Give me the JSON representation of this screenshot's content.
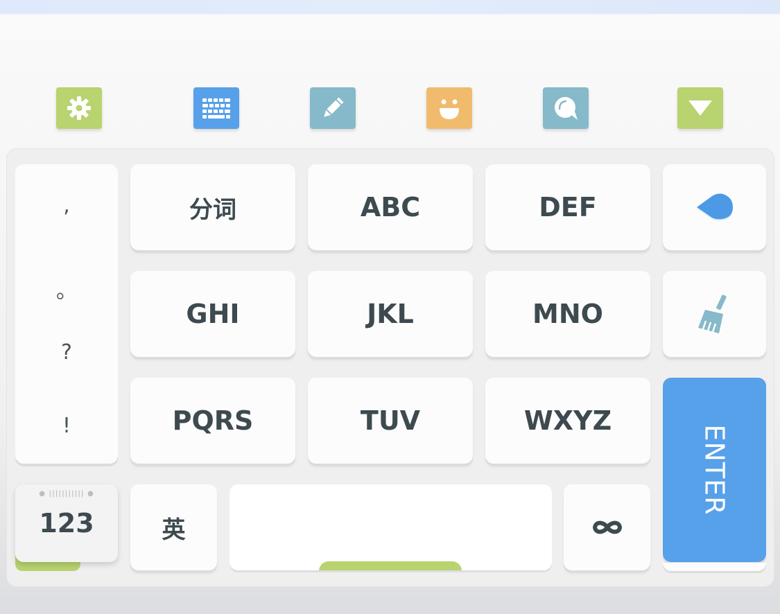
{
  "toolbar": {
    "items": [
      {
        "name": "settings",
        "icon": "gear-icon",
        "color": "#b8d36f"
      },
      {
        "name": "keyboard",
        "icon": "keyboard-icon",
        "color": "#57a0ea"
      },
      {
        "name": "handwriting",
        "icon": "pencil-icon",
        "color": "#86b9c9"
      },
      {
        "name": "emoji",
        "icon": "smiley-icon",
        "color": "#f0bb6c"
      },
      {
        "name": "chat",
        "icon": "chat-bubble-icon",
        "color": "#86b9c9"
      },
      {
        "name": "collapse",
        "icon": "triangle-down-icon",
        "color": "#b8d36f"
      }
    ]
  },
  "keyboard": {
    "punctuation": [
      ",",
      "。",
      "?",
      "!"
    ],
    "keys": {
      "fenci": "分词",
      "abc": "ABC",
      "def": "DEF",
      "ghi": "GHI",
      "jkl": "JKL",
      "mno": "MNO",
      "pqrs": "PQRS",
      "tuv": "TUV",
      "wxyz": "WXYZ"
    },
    "delete_icon": "delete-drop-icon",
    "clear_icon": "broom-icon",
    "enter_label": "ENTER",
    "num_label": "123",
    "lang_label": "英",
    "loop_icon": "infinity-icon",
    "space_label": "",
    "colors": {
      "enter": "#57a0ea",
      "accent_green": "#b8d36f",
      "key_text": "#3d4a4f"
    }
  }
}
